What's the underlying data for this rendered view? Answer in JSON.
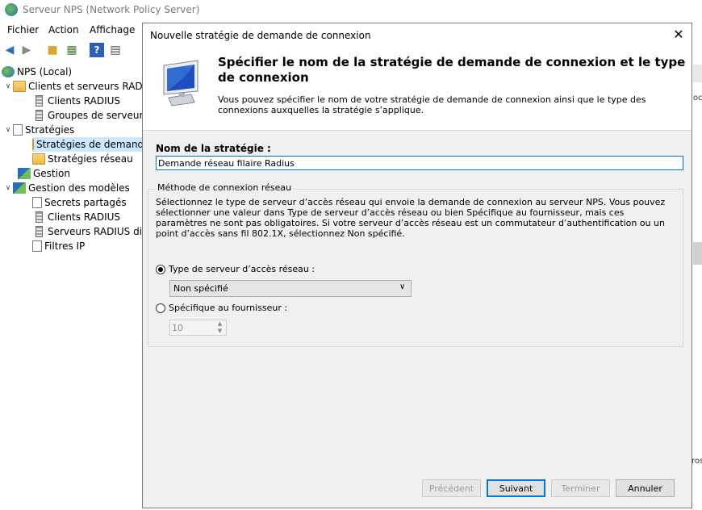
{
  "app": {
    "title": "Serveur NPS (Network Policy Server)"
  },
  "menu": {
    "items": [
      "Fichier",
      "Action",
      "Affichage"
    ]
  },
  "tree": {
    "items": [
      {
        "label": "NPS (Local)"
      },
      {
        "label": "Clients et serveurs RADIUS"
      },
      {
        "label": "Clients RADIUS"
      },
      {
        "label": "Groupes de serveurs RADIUS"
      },
      {
        "label": "Stratégies"
      },
      {
        "label": "Stratégies de demande de connexion"
      },
      {
        "label": "Stratégies réseau"
      },
      {
        "label": "Gestion"
      },
      {
        "label": "Gestion des modèles"
      },
      {
        "label": "Secrets partagés"
      },
      {
        "label": "Clients RADIUS"
      },
      {
        "label": "Serveurs RADIUS distants"
      },
      {
        "label": "Filtres IP"
      }
    ]
  },
  "right_panel": {
    "fragment_top": "oc",
    "fragment_bottom": "ros"
  },
  "dialog": {
    "title": "Nouvelle stratégie de demande de connexion",
    "close_glyph": "✕",
    "header_title": "Spécifier le nom de la stratégie de demande de connexion et le type de connexion",
    "header_desc": "Vous pouvez spécifier le nom de votre stratégie de demande de connexion ainsi que le type des connexions auxquelles la stratégie s’applique.",
    "policy_name_label": "Nom de la stratégie :",
    "policy_name_value": "Demande réseau filaire Radius",
    "group_title": "Méthode de connexion réseau",
    "group_desc": "Sélectionnez le type de serveur d’accès réseau qui envoie la demande de connexion au serveur NPS. Vous pouvez sélectionner une valeur dans Type de serveur d’accès réseau ou bien Spécifique au fournisseur, mais ces paramètres ne sont pas obligatoires. Si votre serveur d’accès réseau est un commutateur d’authentification ou un point d’accès sans fil 802.1X, sélectionnez Non spécifié.",
    "radio_nas_label": "Type de serveur d’accès réseau :",
    "radio_nas_selected": true,
    "nas_type_value": "Non spécifié",
    "radio_vendor_label": "Spécifique au fournisseur :",
    "vendor_value": "10",
    "buttons": {
      "prev": "Précédent",
      "next": "Suivant",
      "finish": "Terminer",
      "cancel": "Annuler"
    }
  },
  "colors": {
    "accent": "#0078d7",
    "selection": "#cce8ff"
  }
}
